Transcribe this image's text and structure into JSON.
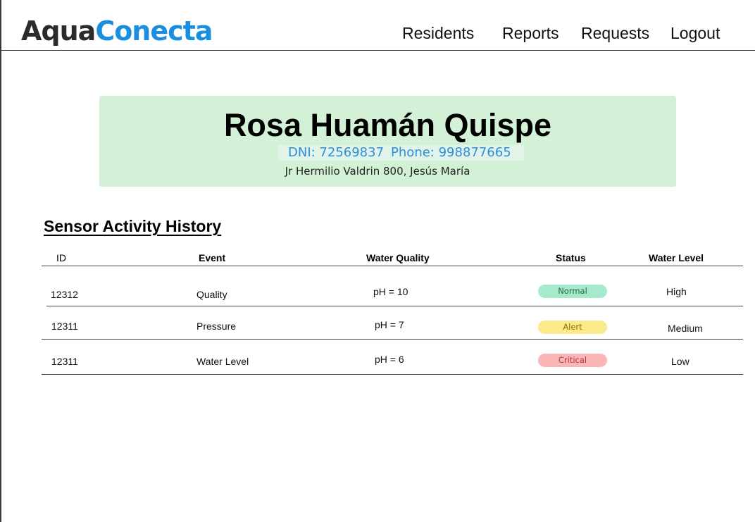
{
  "header": {
    "logo_part1": "Aqua",
    "logo_part2": "Conecta",
    "nav": [
      "Residents",
      "Reports",
      "Requests",
      "Logout"
    ]
  },
  "resident": {
    "name": "Rosa Huamán Quispe",
    "dni": "DNI: 72569837",
    "phone": "Phone: 998877665",
    "address": "Jr Hermilio Valdrin 800, Jesús María"
  },
  "history": {
    "title": "Sensor Activity History",
    "columns": [
      "ID",
      "Event",
      "Water Quality",
      "Status",
      "Water Level"
    ],
    "rows": [
      {
        "id": "12312",
        "event": "Quality",
        "quality": "pH = 10",
        "status": "Normal",
        "level": "High"
      },
      {
        "id": "12311",
        "event": "Pressure",
        "quality": "pH = 7",
        "status": "Alert",
        "level": "Medium"
      },
      {
        "id": "12311",
        "event": "Water Level",
        "quality": "pH = 6",
        "status": "Critical",
        "level": "Low"
      }
    ]
  },
  "colors": {
    "brand_blue": "#1a8fe0",
    "card_bg": "#d3f1d6",
    "status_normal": "#a6e9cc",
    "status_alert": "#fbe98a",
    "status_critical": "#f9b6b6"
  }
}
